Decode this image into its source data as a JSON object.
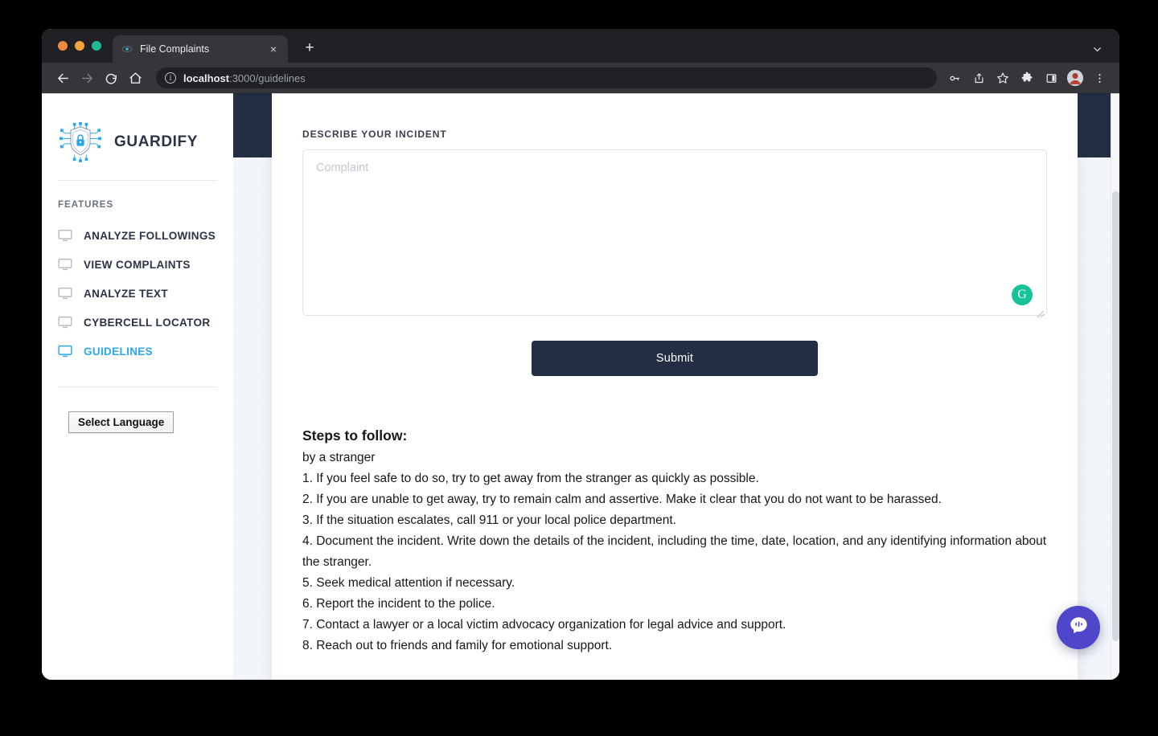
{
  "browser": {
    "tab": {
      "title": "File Complaints",
      "favicon": "guardify-favicon",
      "close_label": "×"
    },
    "new_tab_label": "+",
    "tab_list_icon": "chevron-down-icon",
    "nav": {
      "back_icon": "back-arrow-icon",
      "forward_icon": "forward-arrow-icon",
      "reload_icon": "reload-icon",
      "home_icon": "home-icon"
    },
    "omnibox": {
      "site_info_icon": "info-circle-icon",
      "url_host": "localhost",
      "url_path": ":3000/guidelines"
    },
    "toolbar_icons": [
      "key-icon",
      "share-icon",
      "bookmark-star-icon",
      "extensions-puzzle-icon",
      "side-panel-icon",
      "profile-avatar-icon",
      "three-dot-menu-icon"
    ]
  },
  "sidebar": {
    "brand": {
      "name": "GUARDIFY",
      "logo_icon": "shield-lock-circuit-logo"
    },
    "features_heading": "FEATURES",
    "items": [
      {
        "label": "ANALYZE FOLLOWINGS",
        "icon": "monitor-icon",
        "active": false
      },
      {
        "label": "VIEW COMPLAINTS",
        "icon": "monitor-icon",
        "active": false
      },
      {
        "label": "ANALYZE TEXT",
        "icon": "monitor-icon",
        "active": false
      },
      {
        "label": "CYBERCELL LOCATOR",
        "icon": "monitor-icon",
        "active": false
      },
      {
        "label": "GUIDELINES",
        "icon": "monitor-icon",
        "active": true
      }
    ],
    "language_select": {
      "label": "Select Language"
    }
  },
  "main": {
    "section_label": "DESCRIBE YOUR INCIDENT",
    "complaint": {
      "value": "",
      "placeholder": "Complaint"
    },
    "grammarly_badge": "G",
    "submit_label": "Submit",
    "steps": {
      "title": "Steps to follow:",
      "subtitle": "by a stranger",
      "items": [
        "1. If you feel safe to do so, try to get away from the stranger as quickly as possible.",
        "2. If you are unable to get away, try to remain calm and assertive. Make it clear that you do not want to be harassed.",
        "3. If the situation escalates, call 911 or your local police department.",
        "4. Document the incident. Write down the details of the incident, including the time, date, location, and any identifying information about the stranger.",
        "5. Seek medical attention if necessary.",
        "6. Report the incident to the police.",
        "7. Contact a lawyer or a local victim advocacy organization for legal advice and support.",
        "8. Reach out to friends and family for emotional support."
      ]
    },
    "chat_fab_icon": "chat-bubble-icon"
  },
  "colors": {
    "navy": "#232e44",
    "accent_blue": "#2aa8e8",
    "page_bg": "#f2f5fa",
    "grammarly_green": "#15c39a",
    "chat_purple": "#4f46c9"
  }
}
